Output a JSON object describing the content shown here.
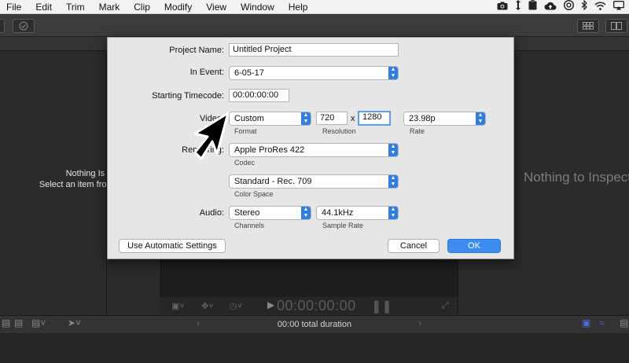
{
  "menubar": {
    "items": [
      "File",
      "Edit",
      "Trim",
      "Mark",
      "Clip",
      "Modify",
      "View",
      "Window",
      "Help"
    ],
    "tray_icons": [
      "camera-icon",
      "updown-icon",
      "clipboard-icon",
      "cloud-icon",
      "chrome-icon",
      "bluetooth-icon",
      "wifi-icon",
      "airplay-icon"
    ]
  },
  "browser": {
    "empty_title": "Nothing Is Selected",
    "empty_hint": "Select an item from the"
  },
  "inspector": {
    "empty_title": "Nothing to Inspect"
  },
  "viewer": {
    "timecode": "00:00:00:00"
  },
  "timeline": {
    "duration": "00:00 total duration"
  },
  "dialog": {
    "project_name_label": "Project Name:",
    "project_name_value": "Untitled Project",
    "in_event_label": "In Event:",
    "in_event_value": "6-05-17",
    "starting_timecode_label": "Starting Timecode:",
    "starting_timecode_value": "00:00:00:00",
    "video_label": "Video:",
    "format_value": "Custom",
    "format_caption": "Format",
    "width_value": "720",
    "x_separator": "x",
    "height_value": "1280",
    "resolution_caption": "Resolution",
    "rate_value": "23.98p",
    "rate_caption": "Rate",
    "render_label": "Rendering:",
    "codec_value": "Apple ProRes 422",
    "codec_caption": "Codec",
    "color_space_value": "Standard - Rec. 709",
    "color_space_caption": "Color Space",
    "audio_label": "Audio:",
    "channels_value": "Stereo",
    "channels_caption": "Channels",
    "sample_rate_value": "44.1kHz",
    "sample_rate_caption": "Sample Rate",
    "auto_button": "Use Automatic Settings",
    "cancel_button": "Cancel",
    "ok_button": "OK"
  },
  "colors": {
    "accent": "#3d8cf0",
    "dialog_bg": "#e6e6e6",
    "app_bg": "#2a2a2a"
  }
}
